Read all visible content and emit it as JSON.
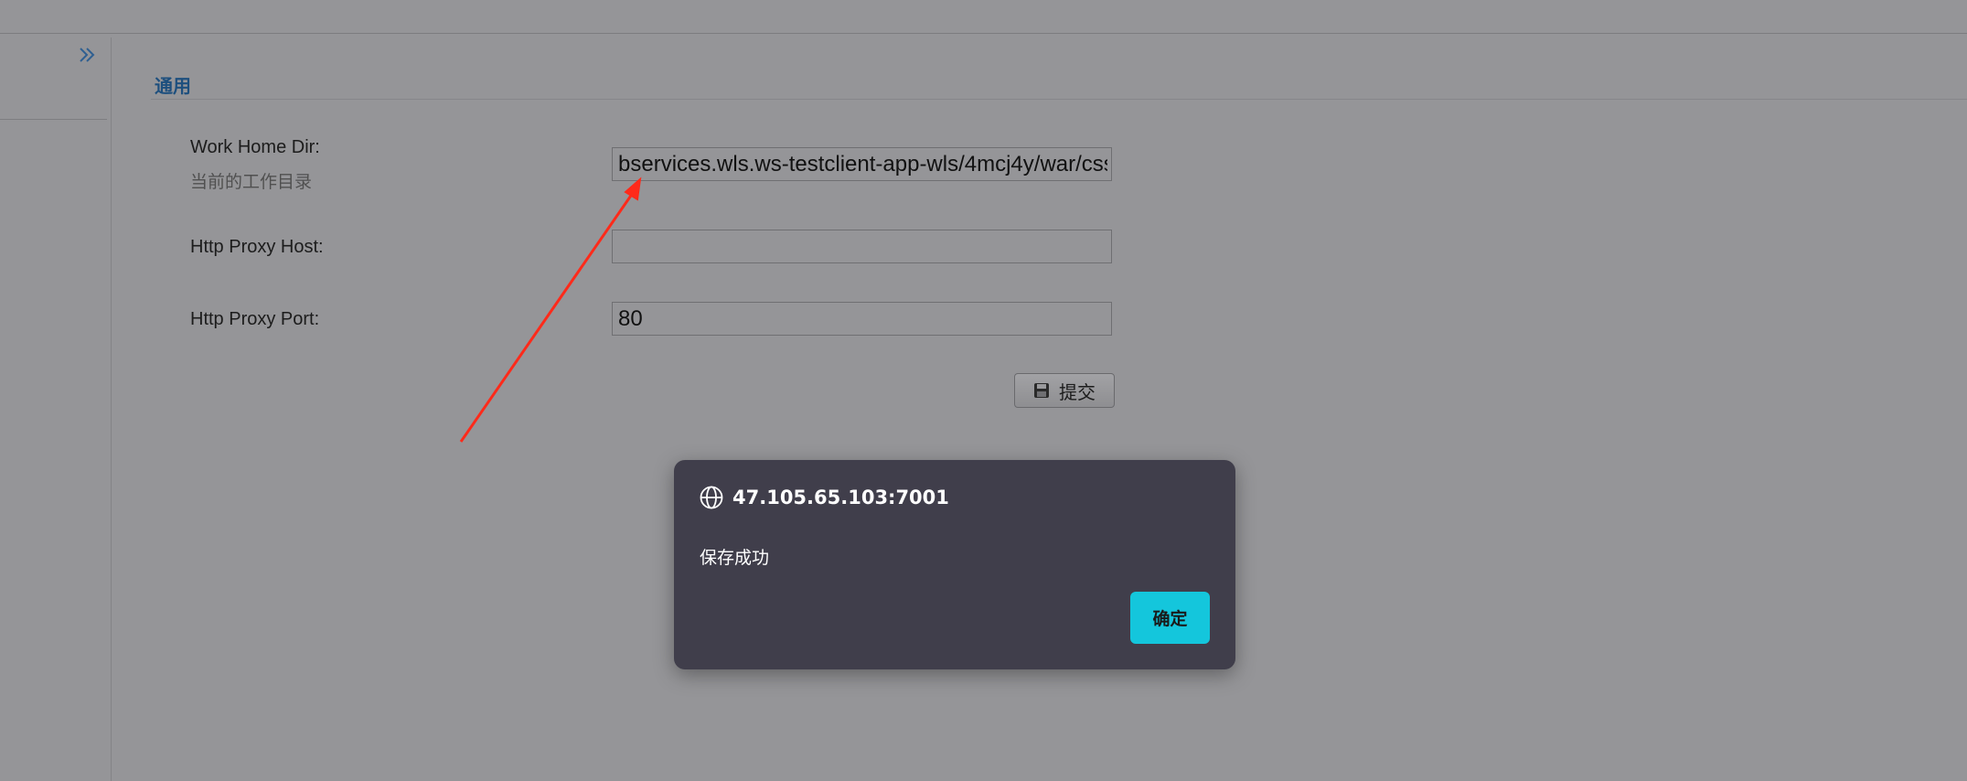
{
  "section": {
    "title": "通用"
  },
  "fields": {
    "work_home_dir": {
      "label": "Work Home Dir:",
      "sublabel": "当前的工作目录",
      "value": "bservices.wls.ws-testclient-app-wls/4mcj4y/war/css"
    },
    "proxy_host": {
      "label": "Http Proxy Host:",
      "value": ""
    },
    "proxy_port": {
      "label": "Http Proxy Port:",
      "value": "80"
    }
  },
  "submit": {
    "label": "提交",
    "icon": "save-icon"
  },
  "sidebar": {
    "toggle_icon": "double-chevron-right-icon"
  },
  "dialog": {
    "origin": "47.105.65.103:7001",
    "message": "保存成功",
    "ok_label": "确定",
    "icon": "globe-icon"
  },
  "annotation": {
    "type": "red-arrow",
    "color": "#ff2a1a"
  },
  "colors": {
    "section_title": "#1d4f7e",
    "dialog_bg": "#403e4b",
    "dialog_button": "#14c6dc"
  }
}
